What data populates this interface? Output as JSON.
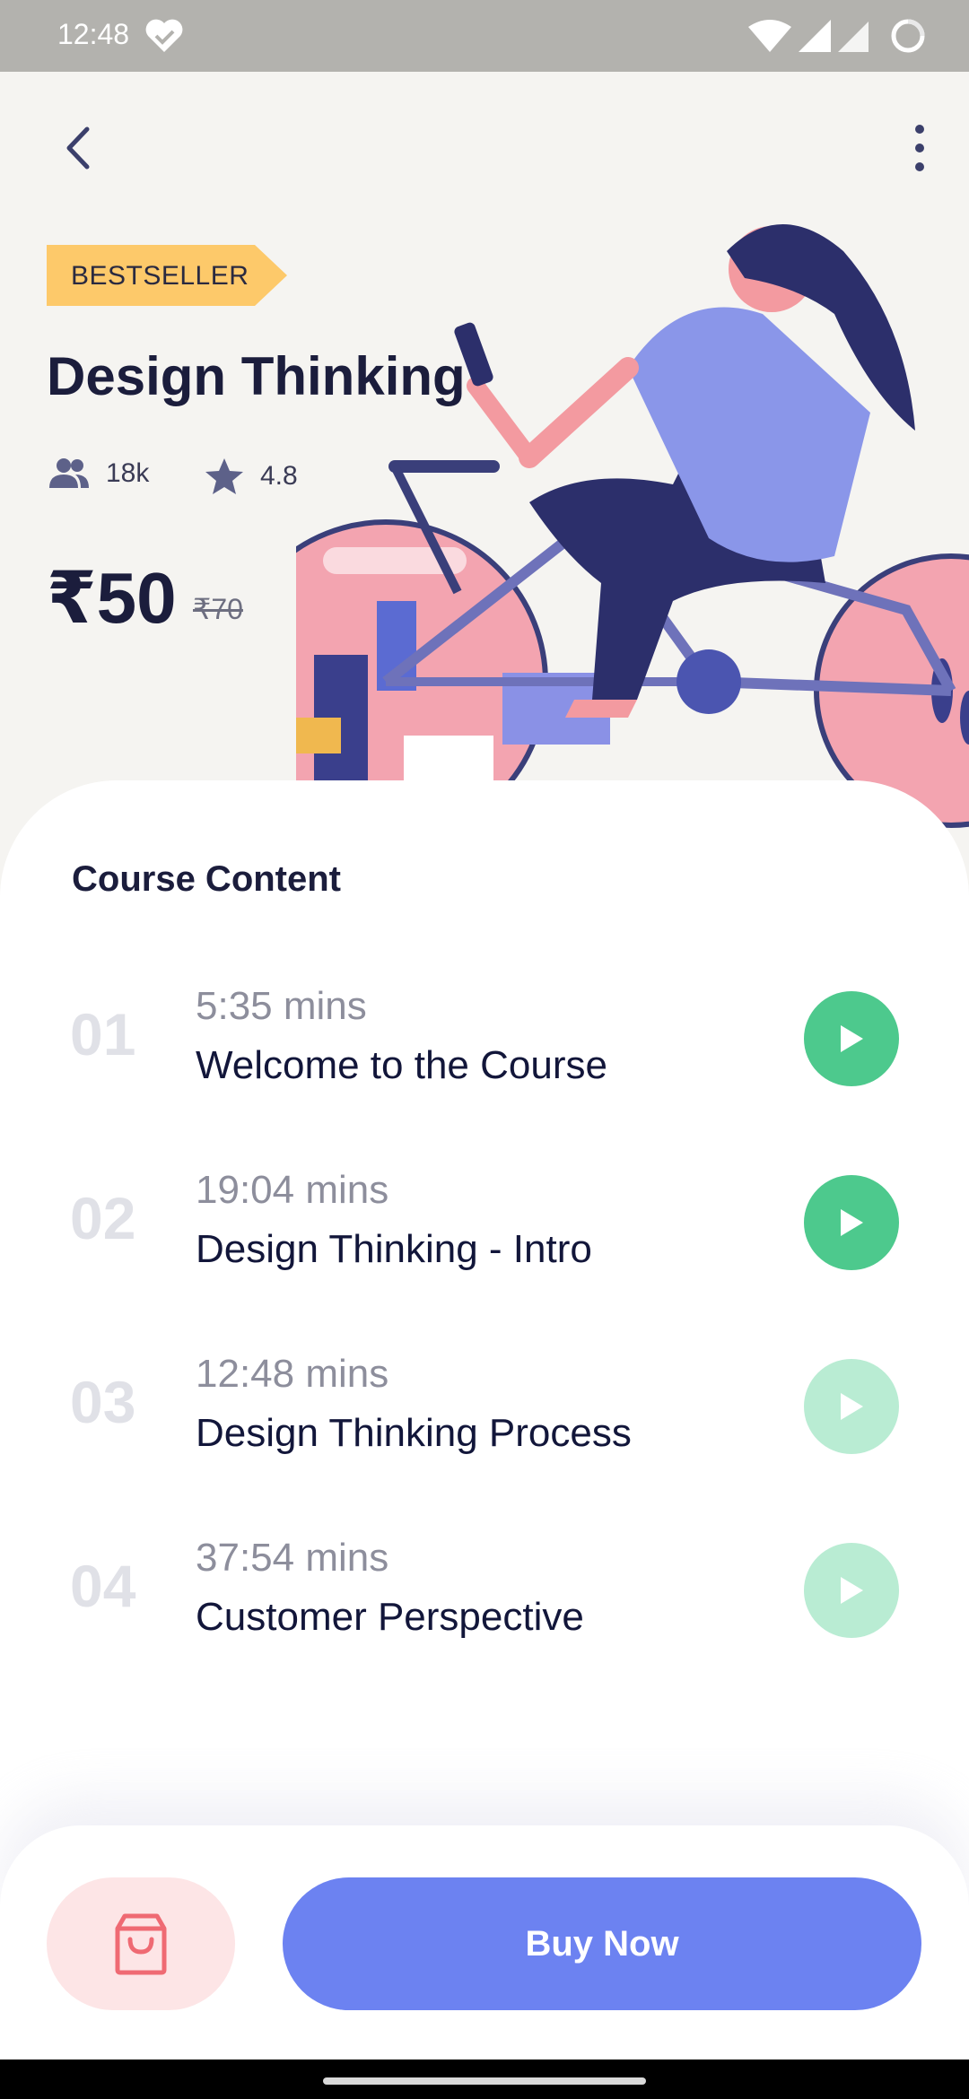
{
  "status_bar": {
    "time": "12:48"
  },
  "header": {
    "badge": "BESTSELLER",
    "title": "Design Thinking",
    "students": "18k",
    "rating": "4.8",
    "price": "₹50",
    "old_price": "₹70"
  },
  "content": {
    "section_title": "Course Content",
    "lessons": [
      {
        "number": "01",
        "duration": "5:35 mins",
        "title": "Welcome to the Course",
        "state": "unlocked"
      },
      {
        "number": "02",
        "duration": "19:04 mins",
        "title": "Design Thinking - Intro",
        "state": "unlocked"
      },
      {
        "number": "03",
        "duration": "12:48 mins",
        "title": "Design Thinking Process",
        "state": "locked"
      },
      {
        "number": "04",
        "duration": "37:54 mins",
        "title": "Customer Perspective",
        "state": "locked"
      }
    ]
  },
  "footer": {
    "buy_label": "Buy Now"
  },
  "colors": {
    "accent": "#6c82f1",
    "play_active": "#4dc98d",
    "play_inactive": "#b9ecd3",
    "badge": "#fdc96a",
    "cart_bg": "#fde5e6",
    "cart_icon": "#ef6a73"
  },
  "icons": [
    "back-arrow-icon",
    "more-vertical-icon",
    "users-icon",
    "star-icon",
    "play-icon",
    "shopping-bag-icon"
  ]
}
